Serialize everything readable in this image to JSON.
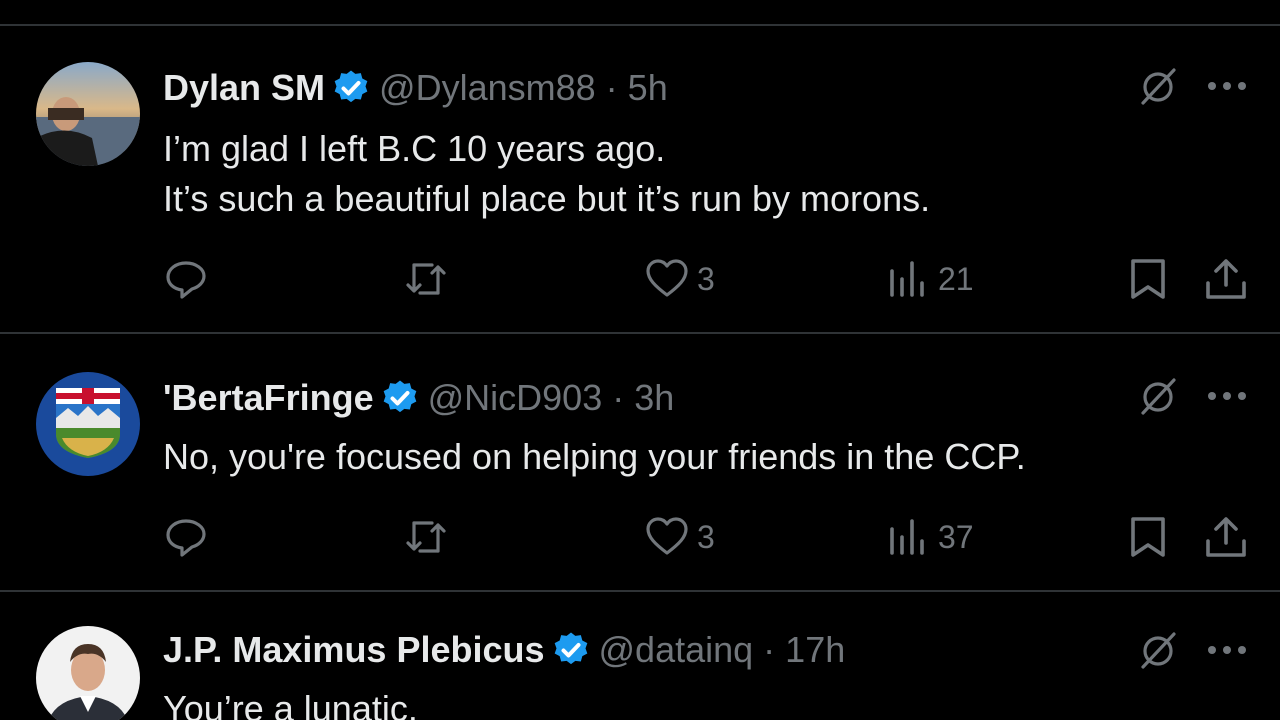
{
  "colors": {
    "background": "#000000",
    "text_primary": "#e7e9ea",
    "text_secondary": "#71767b",
    "verified": "#1d9bf0",
    "divider": "#2f3336"
  },
  "tweets": [
    {
      "name": "Dylan SM",
      "handle": "@Dylansm88",
      "dot": "·",
      "time": "5h",
      "lines": [
        "I’m glad I left B.C 10 years ago.",
        "It’s such a beautiful place but it’s run by morons."
      ],
      "likes": "3",
      "views": "21",
      "avatar_icon": "profile-photo-sunset"
    },
    {
      "name": "'BertaFringe",
      "handle": "@NicD903",
      "dot": "·",
      "time": "3h",
      "lines": [
        "No, you're focused on helping your friends in the CCP."
      ],
      "likes": "3",
      "views": "37",
      "avatar_icon": "alberta-coat-of-arms"
    },
    {
      "name": "J.P. Maximus Plebicus",
      "handle": "@datainq",
      "dot": "·",
      "time": "17h",
      "lines": [
        "You’re a lunatic."
      ],
      "avatar_icon": "profile-photo-man-suit"
    }
  ]
}
